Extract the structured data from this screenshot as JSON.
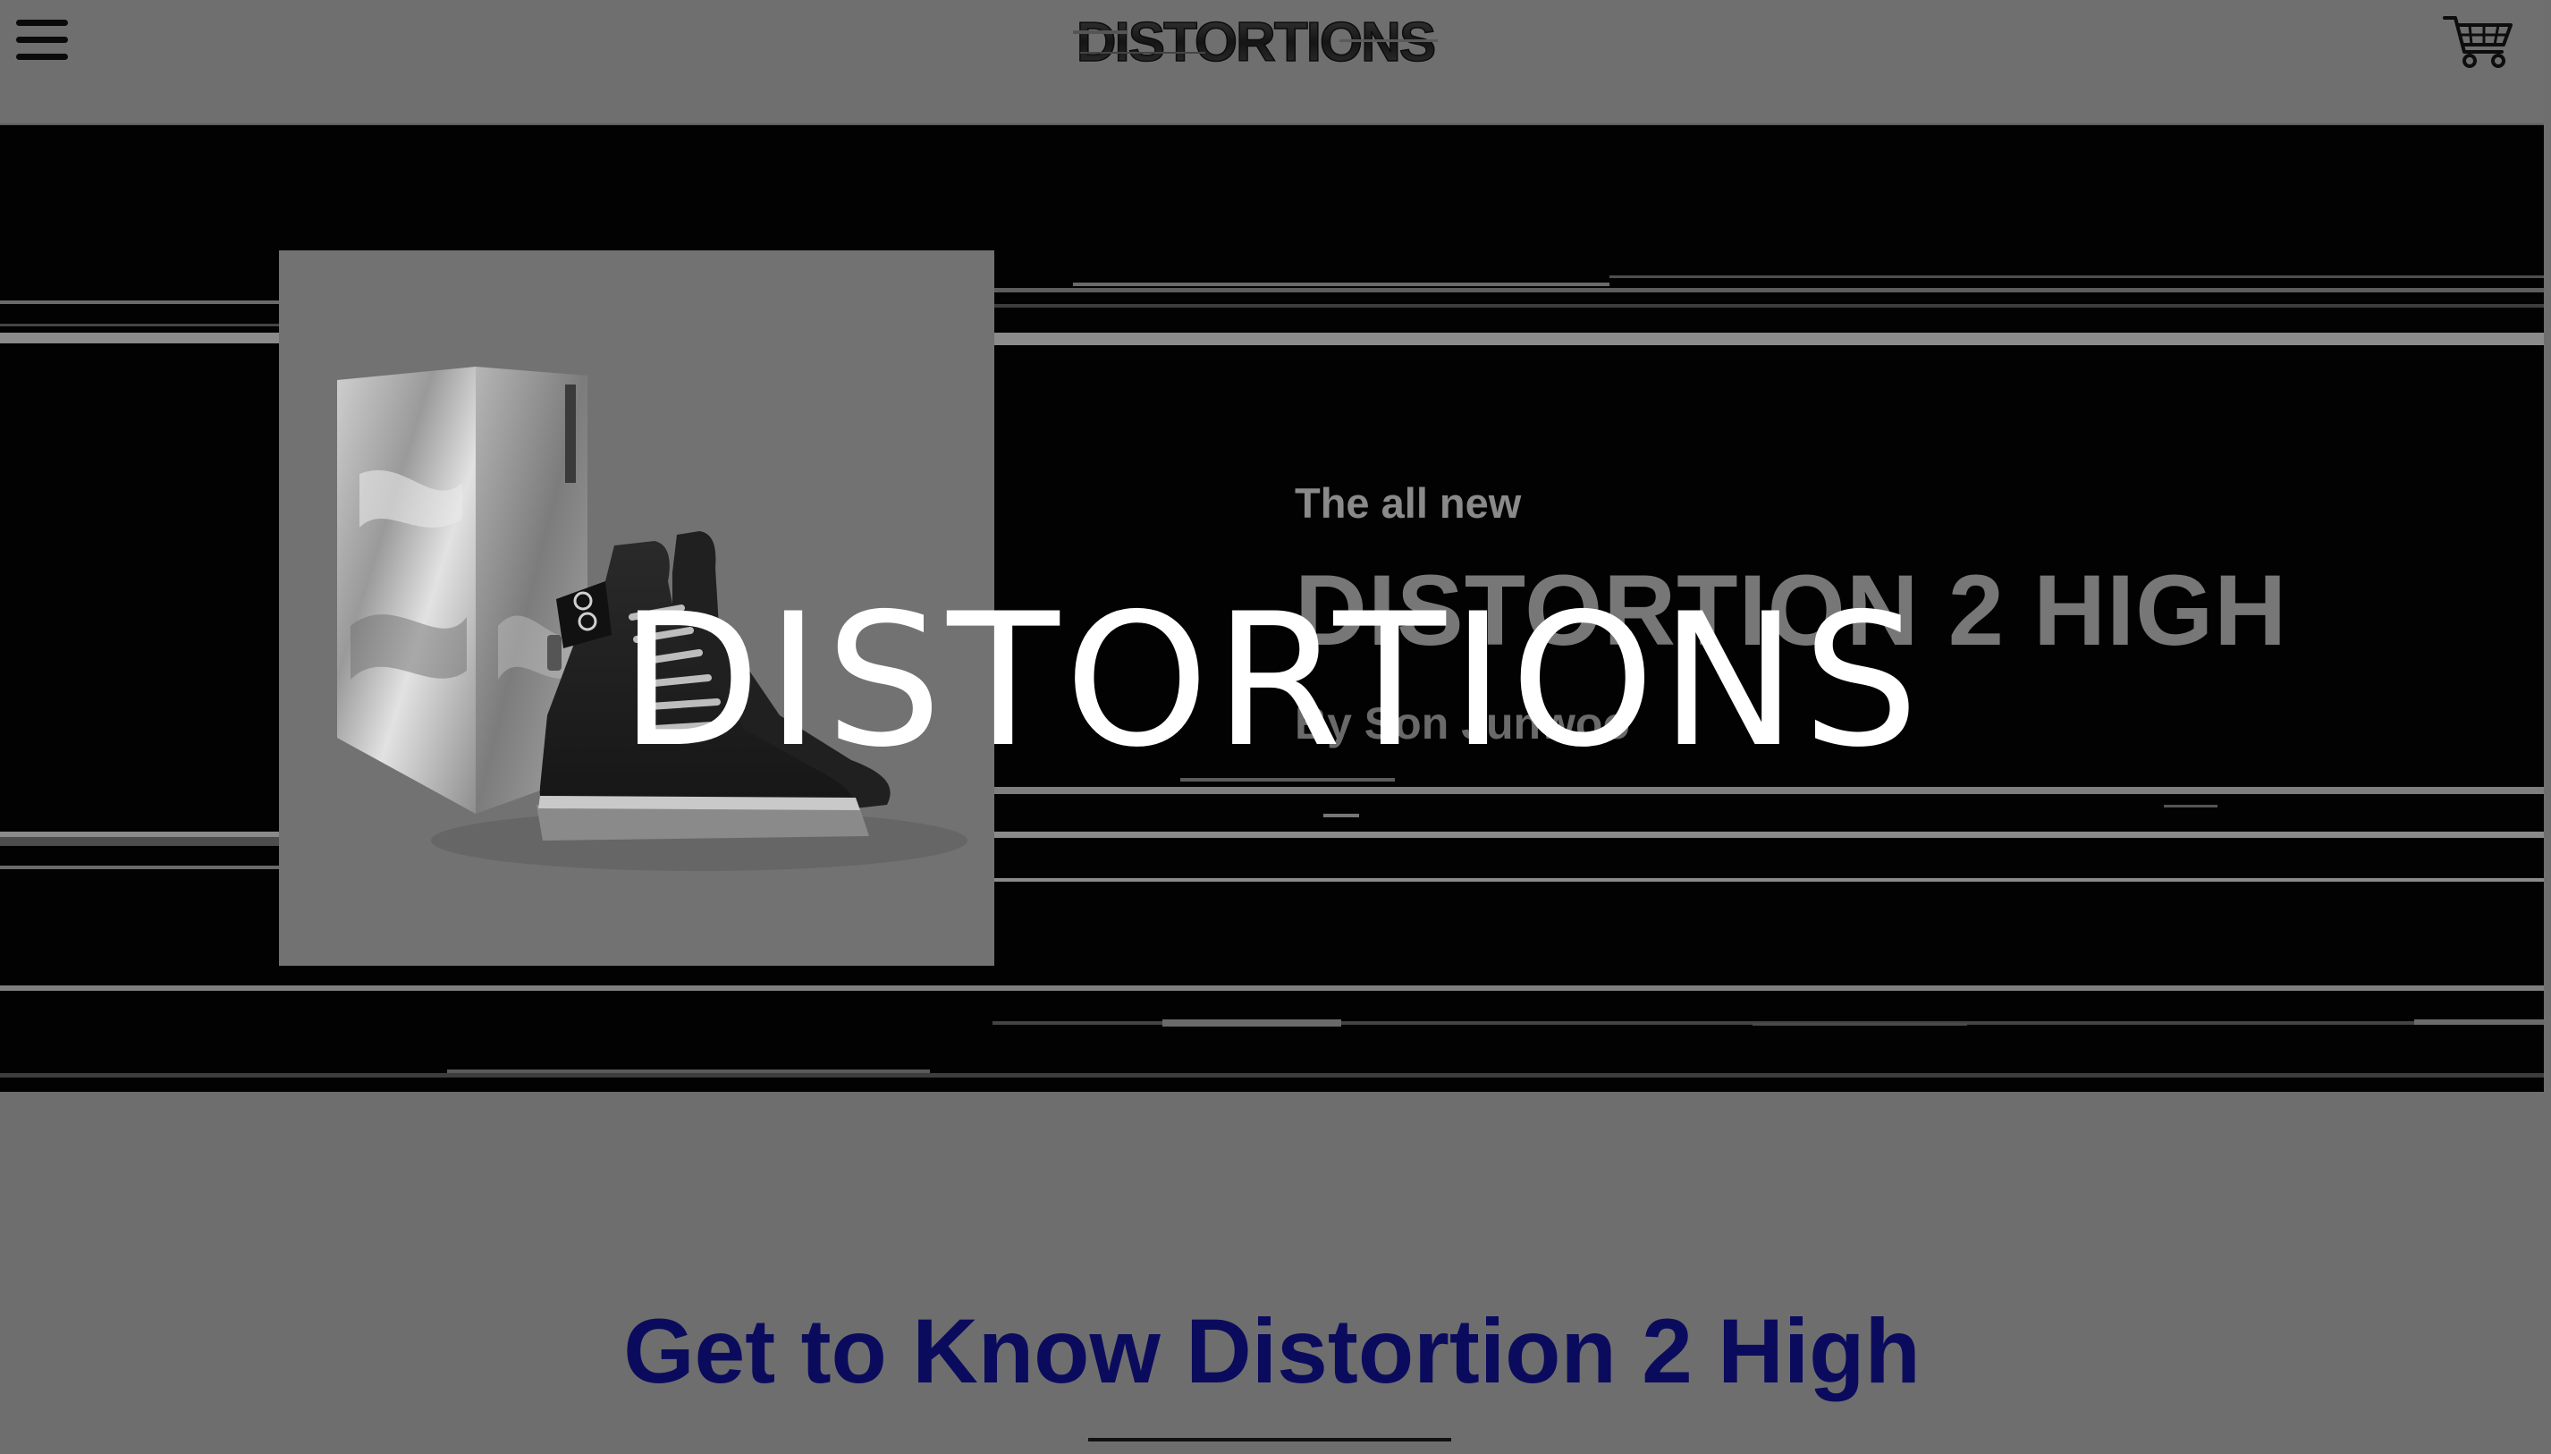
{
  "header": {
    "menu_icon": "hamburger-menu-icon",
    "logo_text": "DISTORTIONS",
    "cart_icon": "shopping-cart-icon"
  },
  "hero": {
    "eyebrow": "The all new",
    "product_name": "DISTORTION 2 HIGH",
    "byline": "By Son Junwoo",
    "overlay_brand": "DISTORTIONS",
    "product_image": "high-top-sneaker-with-box"
  },
  "section": {
    "heading": "Get to Know Distortion 2 High"
  },
  "colors": {
    "page_bg": "#6e6e6e",
    "hero_bg": "#020202",
    "heading": "#0b0b5e",
    "overlay_text": "#ffffff"
  }
}
